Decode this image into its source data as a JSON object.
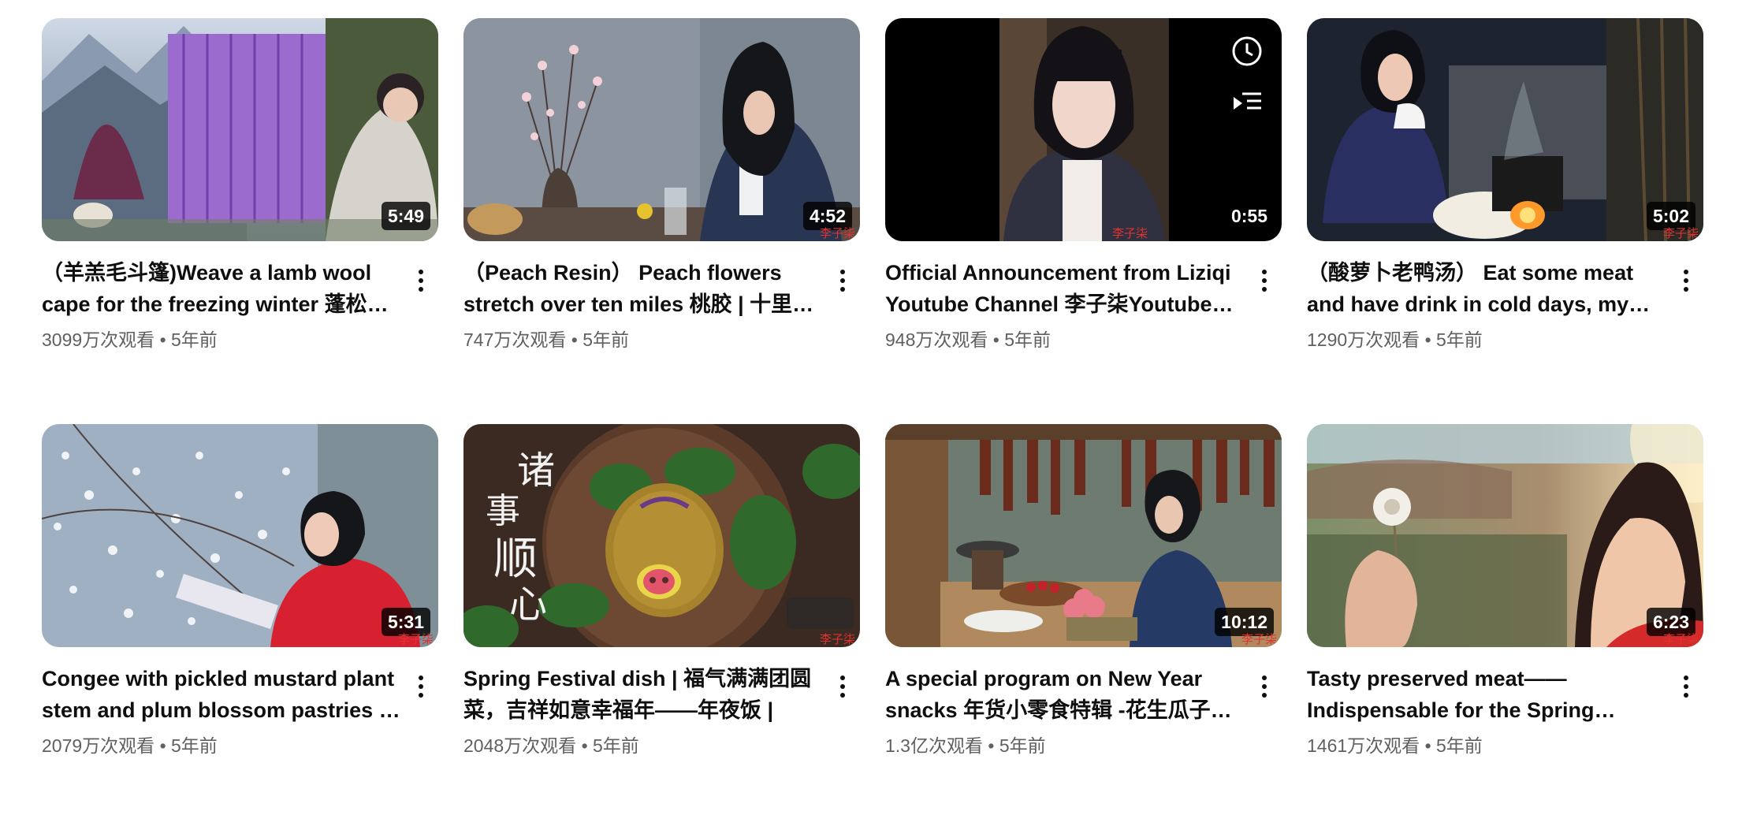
{
  "videos": [
    {
      "title": "（羊羔毛斗篷)Weave a lamb wool cape for the freezing winter 蓬松柔软的羊毛斗篷",
      "duration": "5:49",
      "views": "3099万次观看",
      "sep": "•",
      "age": "5年前",
      "watermark": "李子柒"
    },
    {
      "title": "（Peach Resin） Peach flowers stretch over ten miles 桃胶 | 十里桃花",
      "duration": "4:52",
      "views": "747万次观看",
      "sep": "•",
      "age": "5年前",
      "watermark": "李子柒"
    },
    {
      "title": "Official Announcement from Liziqi Youtube Channel 李子柒Youtube官方声明",
      "duration": "0:55",
      "views": "948万次观看",
      "sep": "•",
      "age": "5年前",
      "watermark": "李子柒",
      "hover_icons": [
        "clock-icon",
        "add-to-queue-icon"
      ]
    },
    {
      "title": "（酸萝卜老鸭汤） Eat some meat and have drink in cold days, my dog",
      "duration": "5:02",
      "views": "1290万次观看",
      "sep": "•",
      "age": "5年前",
      "watermark": "李子柒"
    },
    {
      "title": "Congee with pickled mustard plant stem and plum blossom pastries …",
      "duration": "5:31",
      "views": "2079万次观看",
      "sep": "•",
      "age": "5年前",
      "watermark": "李子柒"
    },
    {
      "title": "Spring Festival dish | 福气满满团圆菜，吉祥如意幸福年——年夜饭 |",
      "duration": "",
      "views": "2048万次观看",
      "sep": "•",
      "age": "5年前",
      "watermark": "李子柒",
      "thumb_text": [
        "诸",
        "事",
        "顺",
        "心"
      ]
    },
    {
      "title": "A special program on New Year snacks 年货小零食特辑 -花生瓜子糖果",
      "duration": "10:12",
      "views": "1.3亿次观看",
      "sep": "•",
      "age": "5年前",
      "watermark": "李子柒"
    },
    {
      "title": "Tasty preserved meat—— Indispensable for the Spring Festival",
      "duration": "6:23",
      "views": "1461万次观看",
      "sep": "•",
      "age": "5年前",
      "watermark": "李子柒"
    }
  ],
  "colors": {
    "accent_text": "#0f0f0f",
    "meta_text": "#606060",
    "watermark": "#e0322f"
  }
}
